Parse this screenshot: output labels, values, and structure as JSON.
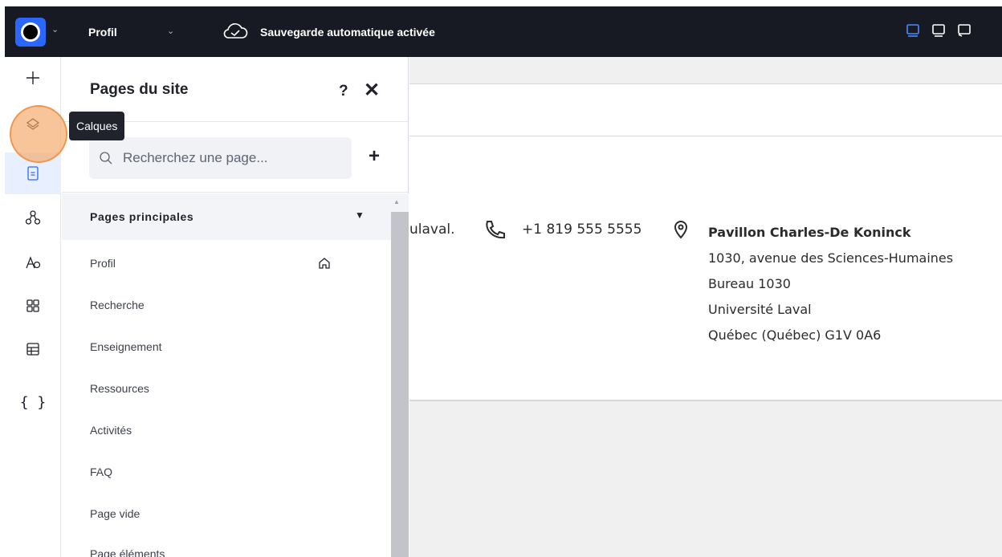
{
  "topbar": {
    "page_name": "Profil",
    "autosave": "Sauvegarde automatique activée"
  },
  "left_tools": {
    "items": [
      "plus-icon",
      "layers-icon",
      "pages-icon",
      "connections-icon",
      "theme-icon",
      "apps-icon",
      "table-icon",
      "code-icon"
    ],
    "tooltip": "Calques"
  },
  "panel": {
    "title": "Pages du site",
    "help": "?",
    "close": "✕",
    "search_placeholder": "Recherchez une page...",
    "add": "+",
    "section_label": "Pages principales",
    "section_arrow": "▼",
    "pages": [
      "Profil",
      "Recherche",
      "Enseignement",
      "Ressources",
      "Activités",
      "FAQ",
      "Page vide",
      "Page éléments"
    ]
  },
  "canvas": {
    "email_fragment": "ulaval.",
    "phone": "+1 819 555 5555",
    "address": {
      "building": "Pavillon Charles-De Koninck",
      "street": "1030, avenue des Sciences-Humaines",
      "office": "Bureau 1030",
      "university": "Université Laval",
      "city": "Québec (Québec) G1V 0A6"
    }
  },
  "colors": {
    "topbar_bg": "#171a22",
    "accent": "#2b67ff",
    "highlight": "#f5a664"
  }
}
